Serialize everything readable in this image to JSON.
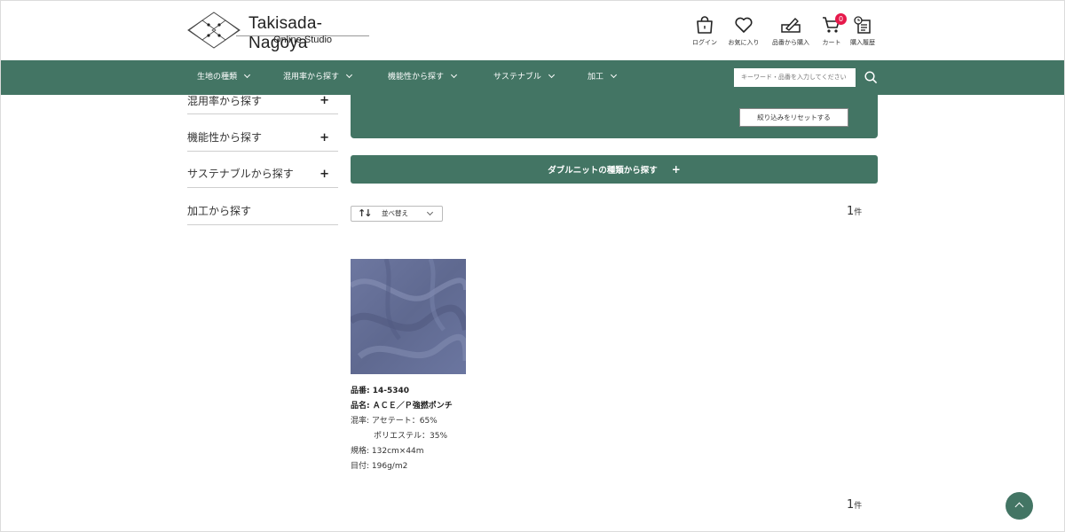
{
  "header": {
    "logo_title": "Takisada-Nagoya",
    "logo_sub": "Online Studio",
    "icons": [
      {
        "name": "login",
        "icon": "shopping-bag-icon",
        "label": "ログイン"
      },
      {
        "name": "favorites",
        "icon": "heart-icon",
        "label": "お気に入り"
      },
      {
        "name": "order-by-number",
        "icon": "pencil-pad-icon",
        "label": "品番から購入"
      },
      {
        "name": "cart",
        "icon": "cart-icon",
        "label": "カート",
        "badge": "0"
      },
      {
        "name": "history",
        "icon": "history-icon",
        "label": "購入履歴"
      }
    ]
  },
  "nav": {
    "items": [
      "生地の種類",
      "混用率から探す",
      "機能性から探す",
      "サステナブル",
      "加工"
    ],
    "search_placeholder": "キーワード・品番を入力してください"
  },
  "sidebar": {
    "items": [
      {
        "label": "混用率から探す",
        "expandable": "+"
      },
      {
        "label": "機能性から探す",
        "expandable": "+"
      },
      {
        "label": "サステナブルから探す",
        "expandable": "+"
      },
      {
        "label": "加工から探す",
        "expandable": ""
      }
    ]
  },
  "filter": {
    "reset_label": "絞り込みをリセットする",
    "category_bar": "ダブルニットの種類から探す",
    "category_plus": "+"
  },
  "list": {
    "sort_label": "並べ替え",
    "count": "1",
    "count_unit": "件"
  },
  "product": {
    "number_line": "品番: 14-5340",
    "name_line": "品名: ＡＣＥ／Ｐ強撚ポンチ",
    "composition_line1": "混率: アセテート：65%",
    "composition_line2": "ポリエステル：35%",
    "size_line": "規格: 132cm×44m",
    "weight_line": "目付: 196g/m2"
  },
  "colors": {
    "brand_green": "#437564",
    "badge_red": "#e6194b"
  }
}
